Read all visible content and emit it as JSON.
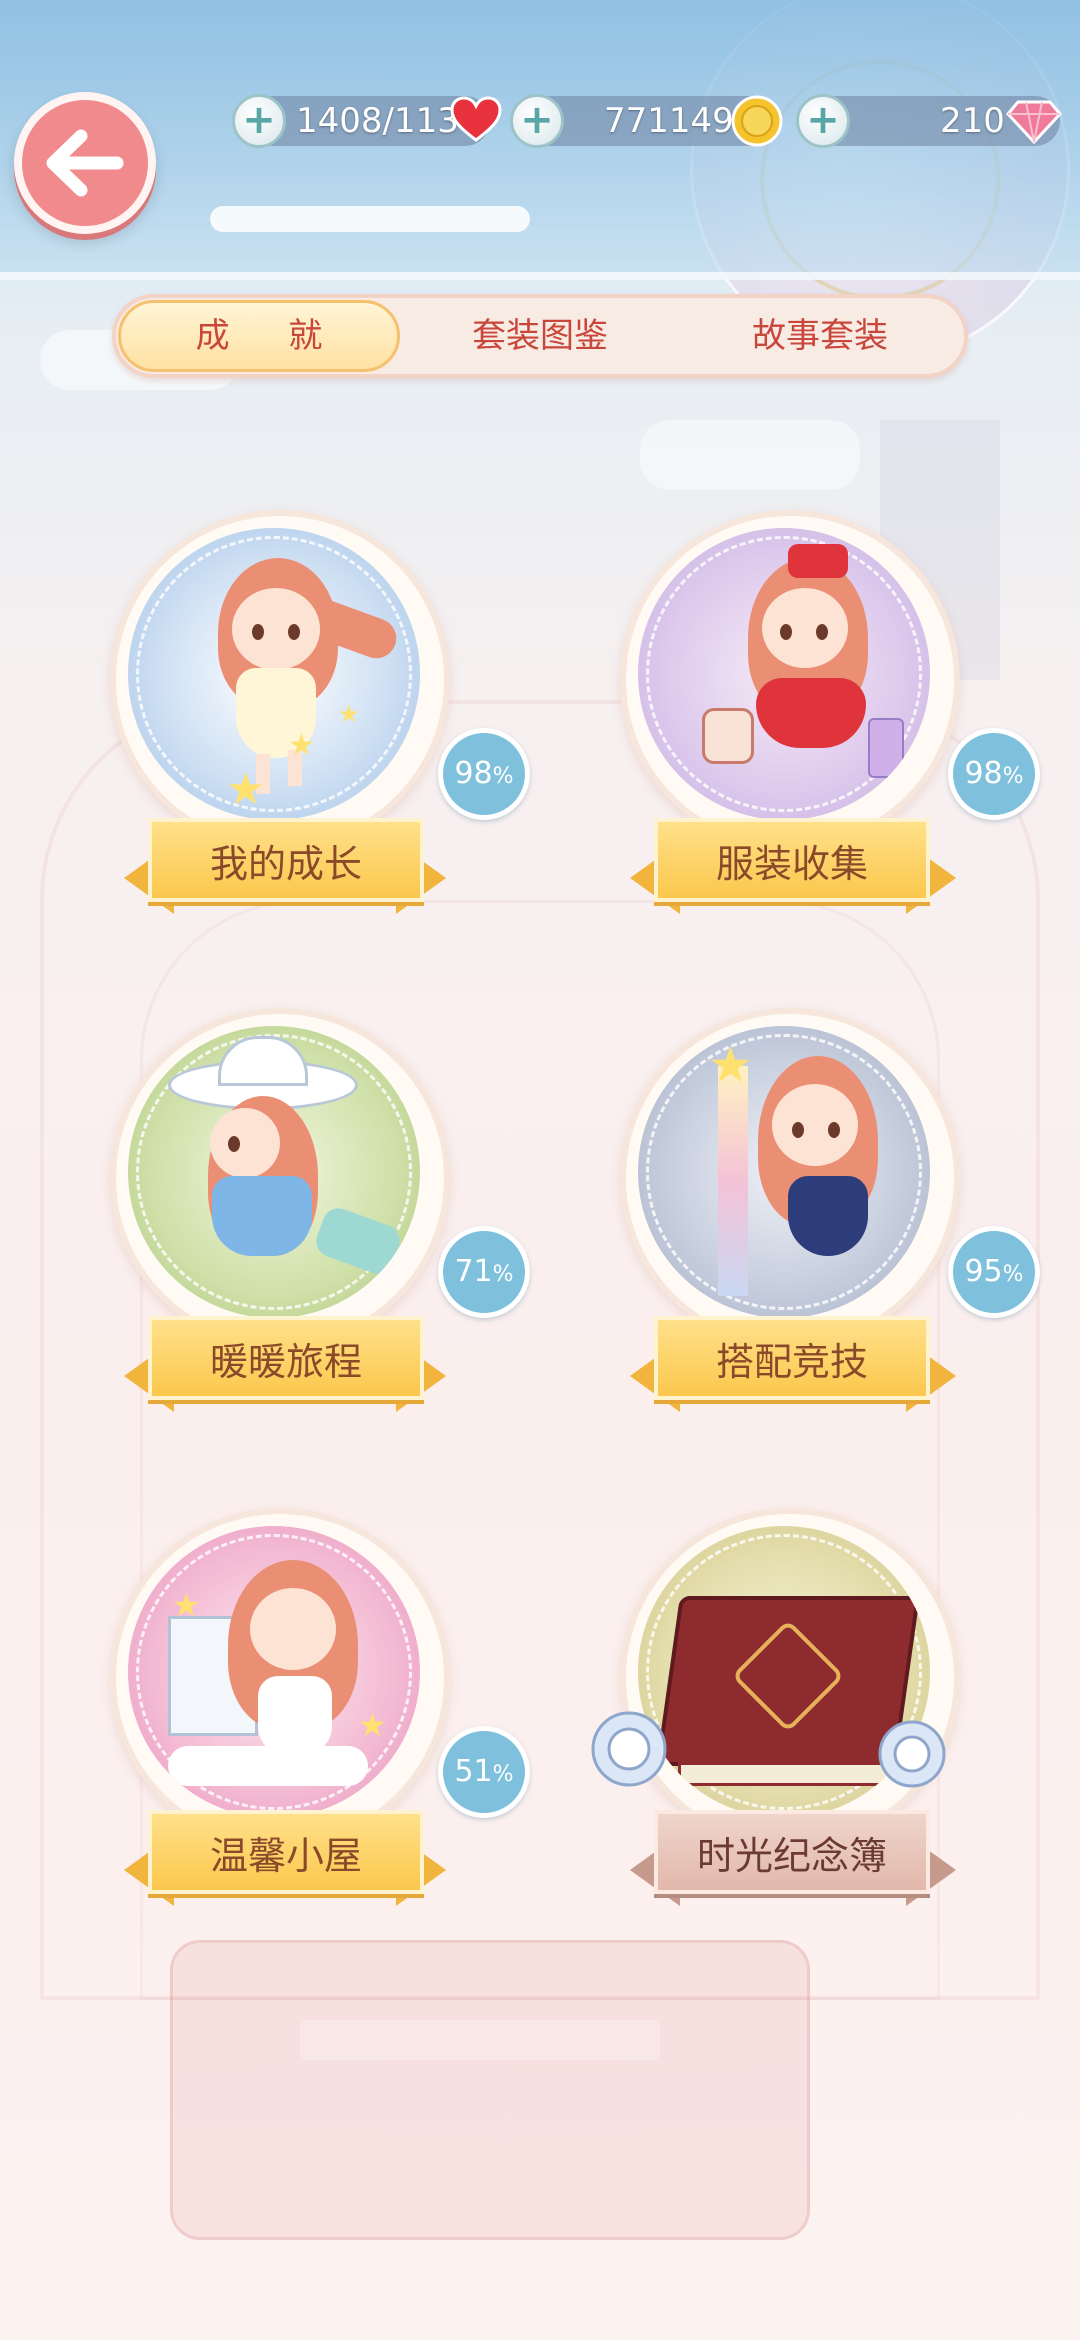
{
  "header": {
    "stamina": "1408/113",
    "gold": "771149",
    "diamonds": "210"
  },
  "tabs": [
    {
      "label": "成 就",
      "active": true
    },
    {
      "label": "套装图鉴",
      "active": false
    },
    {
      "label": "故事套装",
      "active": false
    }
  ],
  "achievements": [
    {
      "title": "我的成长",
      "percent": "98",
      "unit": "%"
    },
    {
      "title": "服装收集",
      "percent": "98",
      "unit": "%"
    },
    {
      "title": "暖暖旅程",
      "percent": "71",
      "unit": "%"
    },
    {
      "title": "搭配竞技",
      "percent": "95",
      "unit": "%"
    },
    {
      "title": "温馨小屋",
      "percent": "51",
      "unit": "%"
    },
    {
      "title": "时光纪念簿"
    }
  ],
  "colors": {
    "accent_red": "#c8463a",
    "ribbon_gold": "#fbc84d",
    "badge_blue": "#7fc1dc",
    "back_button": "#f18a8c"
  },
  "icons": {
    "back": "arrow-left-icon",
    "stamina": "heart-icon",
    "gold": "coin-icon",
    "diamonds": "gem-icon",
    "add": "plus-icon"
  }
}
